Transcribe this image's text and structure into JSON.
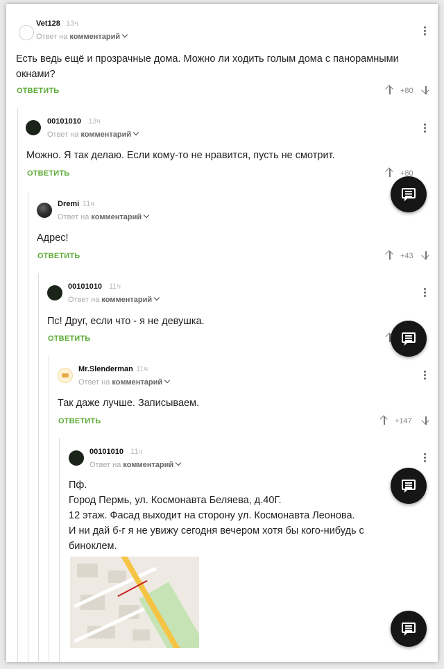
{
  "header_label": "ответ на",
  "comments": [
    {
      "author": "Vet128",
      "time": "13ч",
      "meta_prefix": "Ответ на",
      "meta_target": "комментарий",
      "text": "Есть ведь ещё и прозрачные дома. Можно ли ходить голым дома с панорамными окнами?",
      "reply": "ОТВЕТИТЬ",
      "votes": "+80"
    },
    {
      "author": "00101010",
      "time": "13ч",
      "meta_prefix": "Ответ на",
      "meta_target": "комментарий",
      "text": "Можно. Я так делаю. Если кому-то не нравится, пусть не смотрит.",
      "reply": "ОТВЕТИТЬ",
      "votes": "+80"
    },
    {
      "author": "Dremi",
      "time": "11ч",
      "meta_prefix": "Ответ на",
      "meta_target": "комментарий",
      "text": "Адрес!",
      "reply": "ОТВЕТИТЬ",
      "votes": "+43"
    },
    {
      "author": "00101010",
      "time": "11ч",
      "meta_prefix": "Ответ на",
      "meta_target": "комментарий",
      "text": "Пс! Друг, если что - я не девушка.",
      "reply": "ОТВЕТИТЬ",
      "votes": ""
    },
    {
      "author": "Mr.Slenderman",
      "time": "11ч",
      "meta_prefix": "Ответ на",
      "meta_target": "комментарий",
      "text": "Так даже лучше. Записываем.",
      "reply": "ОТВЕТИТЬ",
      "votes": "+147"
    },
    {
      "author": "00101010",
      "time": "11ч",
      "meta_prefix": "Ответ на",
      "meta_target": "комментарий",
      "lines": [
        "Пф.",
        "Город Пермь, ул. Космонавта Беляева, д.40Г.",
        "12 этаж. Фасад выходит на сторону ул. Космонавта Леонова.",
        "И ни дай б-г я не увижу сегодня вечером хотя бы кого-нибудь с",
        "биноклем."
      ]
    }
  ]
}
